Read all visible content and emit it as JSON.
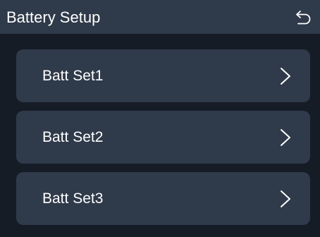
{
  "header": {
    "title": "Battery Setup",
    "back_icon": "back-arrow-icon"
  },
  "menu": {
    "items": [
      {
        "label": "Batt Set1",
        "icon": "chevron-right-icon"
      },
      {
        "label": "Batt Set2",
        "icon": "chevron-right-icon"
      },
      {
        "label": "Batt Set3",
        "icon": "chevron-right-icon"
      }
    ]
  },
  "colors": {
    "background": "#161c26",
    "panel": "#2f3a4a",
    "text": "#ffffff"
  }
}
